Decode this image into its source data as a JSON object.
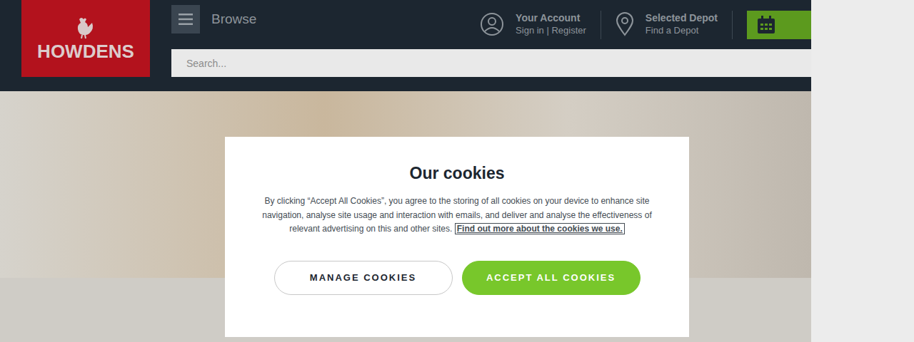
{
  "header": {
    "logo": "HOWDENS",
    "browse": "Browse",
    "account": {
      "title": "Your Account",
      "subtitle": "Sign in | Register"
    },
    "depot": {
      "title": "Selected Depot",
      "subtitle": "Find a Depot"
    }
  },
  "search": {
    "placeholder": "Search..."
  },
  "cookie_dialog": {
    "title": "Our cookies",
    "body": "By clicking “Accept All Cookies”, you agree to the storing of all cookies on your device to enhance site navigation, analyse site usage and interaction with emails, and deliver and analyse the effectiveness of relevant advertising on this and other sites.",
    "link": "Find out more about the cookies we use.",
    "buttons": [
      {
        "label": "MANAGE COOKIES",
        "kind": "secondary"
      },
      {
        "label": "ACCEPT ALL COOKIES",
        "kind": "primary"
      }
    ]
  }
}
